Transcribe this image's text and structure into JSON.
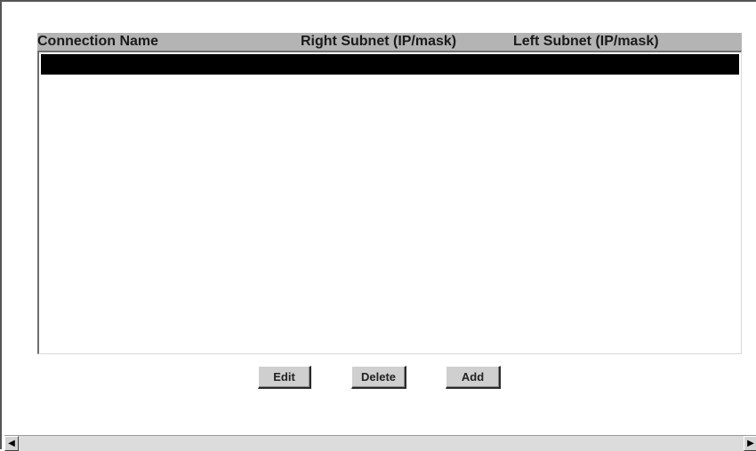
{
  "table": {
    "columns": [
      "Connection Name",
      "Right Subnet (IP/mask)",
      "Left Subnet (IP/mask)"
    ],
    "rows": []
  },
  "buttons": {
    "edit_label": "Edit",
    "delete_label": "Delete",
    "add_label": "Add"
  },
  "scrollbar": {
    "left_arrow": "◀",
    "right_arrow": "▶"
  },
  "colors": {
    "header_background": "#b4b4b4",
    "selection": "#000000",
    "button_face": "#cfcfcf"
  }
}
